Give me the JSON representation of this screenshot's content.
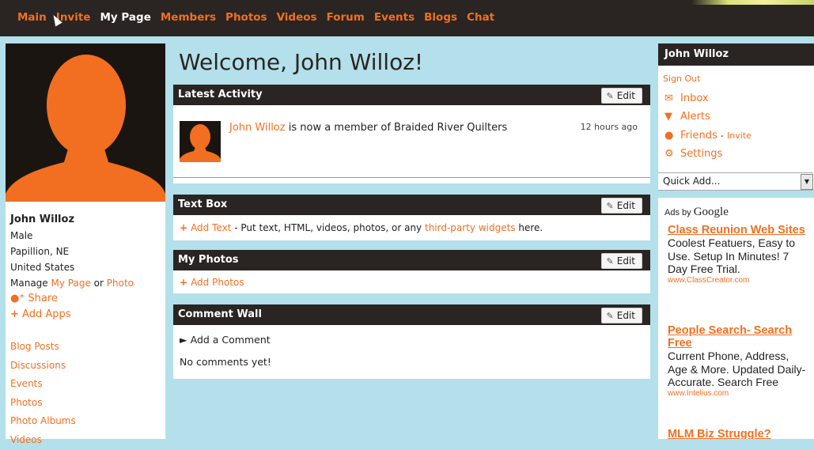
{
  "nav": {
    "items": [
      {
        "label": "Main"
      },
      {
        "label": "Invite"
      },
      {
        "label": "My Page",
        "active": true
      },
      {
        "label": "Members"
      },
      {
        "label": "Photos"
      },
      {
        "label": "Videos"
      },
      {
        "label": "Forum"
      },
      {
        "label": "Events"
      },
      {
        "label": "Blogs"
      },
      {
        "label": "Chat"
      }
    ]
  },
  "profile": {
    "name": "John Willoz",
    "gender": "Male",
    "location": "Papillion, NE",
    "country": "United States",
    "manage_prefix": "Manage",
    "manage_my_page": "My Page",
    "manage_or": "or",
    "manage_photo": "Photo",
    "share": "Share",
    "add_apps": "Add Apps",
    "links": [
      "Blog Posts",
      "Discussions",
      "Events",
      "Photos",
      "Photo Albums",
      "Videos"
    ]
  },
  "main": {
    "welcome": "Welcome, John Willoz!",
    "edit_label": "Edit",
    "latest_activity": {
      "title": "Latest Activity",
      "actor": "John Willoz",
      "text": "is now a member of Braided River Quilters",
      "time": "12 hours ago"
    },
    "text_box": {
      "title": "Text Box",
      "add_text": "Add Text",
      "desc": "- Put text, HTML, videos, photos, or any",
      "widgets_link": "third-party widgets",
      "desc_end": "here."
    },
    "my_photos": {
      "title": "My Photos",
      "add_photos": "Add Photos"
    },
    "comment_wall": {
      "title": "Comment Wall",
      "add_comment": "Add a Comment",
      "empty": "No comments yet!"
    }
  },
  "account": {
    "name": "John Willoz",
    "sign_out": "Sign Out",
    "inbox": "Inbox",
    "alerts": "Alerts",
    "friends": "Friends",
    "friends_sep": "-",
    "invite": "Invite",
    "settings": "Settings",
    "quick_add": "Quick Add..."
  },
  "ads": {
    "adsby": "Ads by",
    "google": "Google",
    "items": [
      {
        "title": "Class Reunion Web Sites",
        "desc": "Coolest Featuers, Easy to Use. Setup In Minutes! 7 Day Free Trial.",
        "url": "www.ClassCreator.com"
      },
      {
        "title": "People Search- Search Free",
        "desc": "Current Phone, Address, Age & More. Updated Daily- Accurate. Search Free",
        "url": "www.Intelius.com"
      },
      {
        "title": "MLM Biz Struggle?",
        "desc": "",
        "url": ""
      }
    ]
  },
  "colors": {
    "accent": "#f26f21",
    "header": "#2a2522",
    "background": "#b3e0ea"
  }
}
